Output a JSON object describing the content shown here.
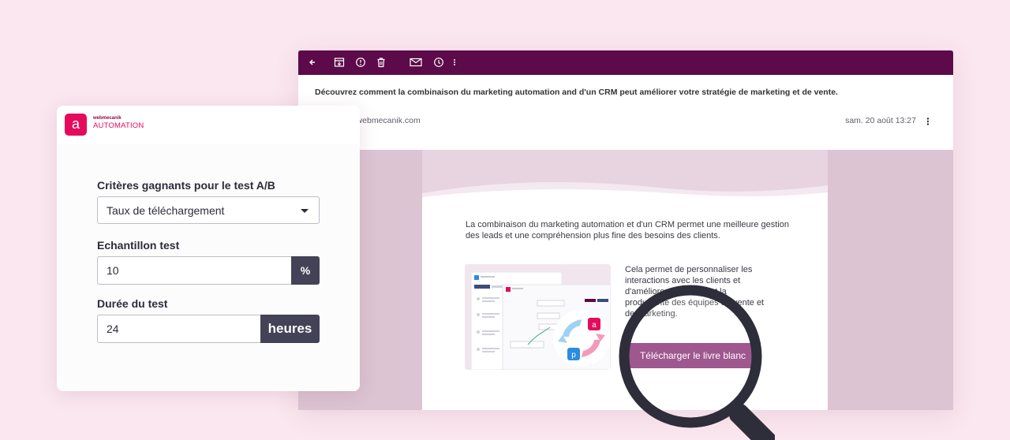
{
  "email": {
    "toolbar_icons": [
      "back-arrow-icon",
      "archive-icon",
      "report-icon",
      "trash-icon",
      "mail-icon",
      "clock-icon",
      "more-vertical-icon"
    ],
    "subject": "Découvrez comment la combinaison du marketing automation and d'un CRM peut améliorer votre stratégie de marketing et de vente.",
    "sender": "tact@webmecanik.com",
    "date": "sam. 20 août 13:27",
    "body_intro": "La combinaison du marketing automation et d'un CRM permet une meilleure gestion des leads et une compréhension plus fine des besoins des clients.",
    "body_side": "Cela permet de personnaliser les interactions avec les clients et d'améliorer l'efficacité et la productivité des équipes de vente et de marketing.",
    "cta_label": "Télécharger le livre blanc"
  },
  "card": {
    "logo_letter": "a",
    "logo_top": "webmecanik",
    "logo_bottom": "AUTOMATION",
    "criteria_label": "Critères gagnants pour le test A/B",
    "criteria_value": "Taux de téléchargement",
    "sample_label": "Echantillon test",
    "sample_value": "10",
    "sample_unit": "%",
    "duration_label": "Durée du test",
    "duration_value": "24",
    "duration_unit": "heures"
  },
  "colors": {
    "background": "#fbe7ef",
    "toolbar": "#5c0a49",
    "brand": "#e50a5c",
    "cta": "#8e3a7c",
    "addon": "#434256"
  }
}
